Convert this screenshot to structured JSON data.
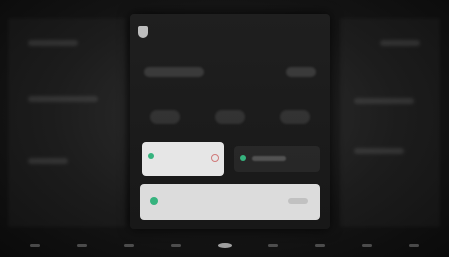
{
  "shade": {
    "header_text": "",
    "notif_a": {
      "title": "",
      "subtitle": ""
    },
    "card": {
      "title": "",
      "subtitle": ""
    }
  },
  "icons": [
    "app-icon",
    "notification-icon",
    "home-icon"
  ],
  "colors": {
    "accent": "#36b37e",
    "shade_bg": "#1b1b1b",
    "card_bg": "#dcdcdc"
  }
}
